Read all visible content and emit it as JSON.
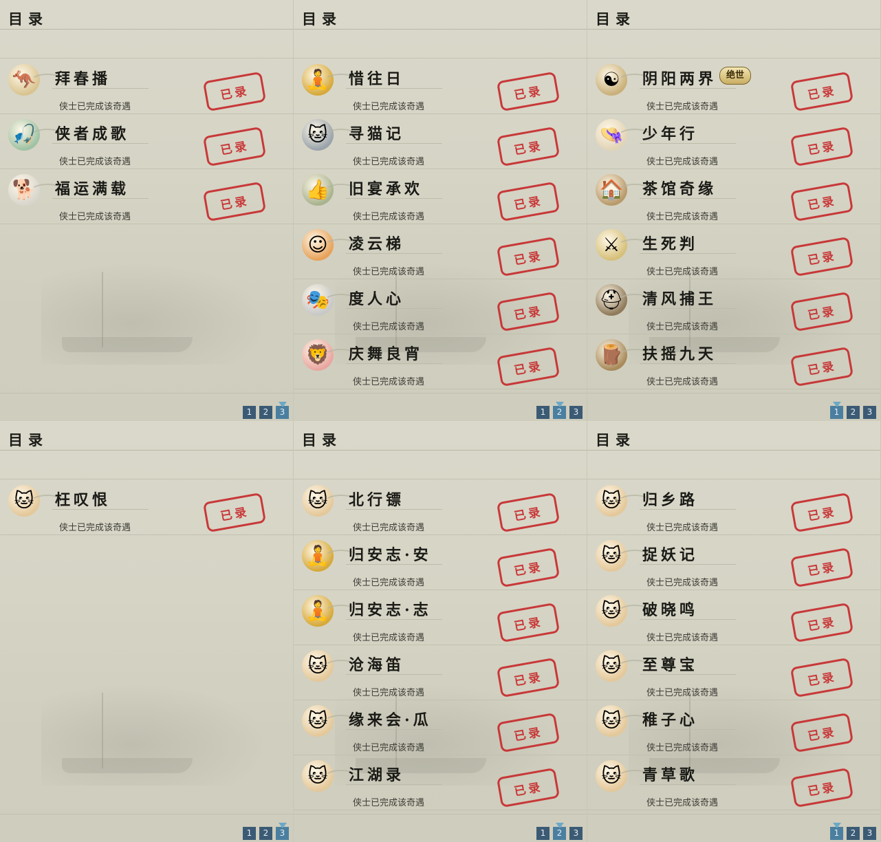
{
  "status_text": "侠士已完成该奇遇",
  "stamp_text": "已录",
  "panels": [
    {
      "title": "目录",
      "pages": [
        "1",
        "2",
        "3"
      ],
      "active_page": 2,
      "items": [
        {
          "name": "拜春播",
          "icon": "kangaroo-icon",
          "glyph": "🦘",
          "bg": "#d9c490"
        },
        {
          "name": "侠者成歌",
          "icon": "fisherman-icon",
          "glyph": "🎣",
          "bg": "#9fc2a4"
        },
        {
          "name": "福运满载",
          "icon": "dog-icon",
          "glyph": "🐕",
          "bg": "#d9d6cd"
        }
      ]
    },
    {
      "title": "目录",
      "pages": [
        "1",
        "2",
        "3"
      ],
      "active_page": 1,
      "items": [
        {
          "name": "惜往日",
          "icon": "gold-buddha-icon",
          "glyph": "🧘",
          "bg": "#d6a93a"
        },
        {
          "name": "寻猫记",
          "icon": "cat-icon",
          "glyph": "🐱",
          "bg": "#9aa3ab"
        },
        {
          "name": "旧宴承欢",
          "icon": "thumbs-up-icon",
          "glyph": "👍",
          "bg": "#a9b38e"
        },
        {
          "name": "凌云梯",
          "icon": "sun-face-icon",
          "glyph": "☺",
          "bg": "#e7a25a"
        },
        {
          "name": "度人心",
          "icon": "mask-icon",
          "glyph": "🎭",
          "bg": "#c8c8c8"
        },
        {
          "name": "庆舞良宵",
          "icon": "lion-dance-icon",
          "glyph": "🦁",
          "bg": "#e9a6a0"
        }
      ]
    },
    {
      "title": "目录",
      "pages": [
        "1",
        "2",
        "3"
      ],
      "active_page": 0,
      "items": [
        {
          "name": "阴阳两界",
          "icon": "yin-yang-icon",
          "glyph": "☯",
          "bg": "#c9b07a",
          "badge": "绝世"
        },
        {
          "name": "少年行",
          "icon": "straw-hat-boy-icon",
          "glyph": "👒",
          "bg": "#e2d4b6"
        },
        {
          "name": "茶馆奇缘",
          "icon": "teahouse-icon",
          "glyph": "🏠",
          "bg": "#b89a6a"
        },
        {
          "name": "生死判",
          "icon": "sword-gold-icon",
          "glyph": "⚔",
          "bg": "#d6c07a"
        },
        {
          "name": "清风捕王",
          "icon": "helmet-icon",
          "glyph": "⛑",
          "bg": "#8f7a5a"
        },
        {
          "name": "扶摇九天",
          "icon": "wooden-post-icon",
          "glyph": "🪵",
          "bg": "#a88a5a"
        }
      ]
    },
    {
      "title": "目录",
      "pages": [
        "1",
        "2",
        "3"
      ],
      "active_page": 2,
      "items": [
        {
          "name": "枉叹恨",
          "icon": "cat-face-icon",
          "glyph": "🐱",
          "bg": "#e4c89a"
        }
      ]
    },
    {
      "title": "目录",
      "pages": [
        "1",
        "2",
        "3"
      ],
      "active_page": 1,
      "items": [
        {
          "name": "北行镖",
          "icon": "cat-face-icon",
          "glyph": "🐱",
          "bg": "#e4c89a"
        },
        {
          "name": "归安志·安",
          "icon": "gold-buddha-icon",
          "glyph": "🧘",
          "bg": "#d6a93a"
        },
        {
          "name": "归安志·志",
          "icon": "gold-buddha-icon",
          "glyph": "🧘",
          "bg": "#d6a93a"
        },
        {
          "name": "沧海笛",
          "icon": "cat-face-icon",
          "glyph": "🐱",
          "bg": "#e4c89a"
        },
        {
          "name": "缘来会·瓜",
          "icon": "cat-face-icon",
          "glyph": "🐱",
          "bg": "#e4c89a"
        },
        {
          "name": "江湖录",
          "icon": "cat-face-icon",
          "glyph": "🐱",
          "bg": "#e4c89a"
        }
      ]
    },
    {
      "title": "目录",
      "pages": [
        "1",
        "2",
        "3"
      ],
      "active_page": 0,
      "items": [
        {
          "name": "归乡路",
          "icon": "cat-face-icon",
          "glyph": "🐱",
          "bg": "#e4c89a"
        },
        {
          "name": "捉妖记",
          "icon": "cat-face-icon",
          "glyph": "🐱",
          "bg": "#e4c89a"
        },
        {
          "name": "破晓鸣",
          "icon": "cat-face-icon",
          "glyph": "🐱",
          "bg": "#e4c89a"
        },
        {
          "name": "至尊宝",
          "icon": "cat-face-icon",
          "glyph": "🐱",
          "bg": "#e4c89a"
        },
        {
          "name": "稚子心",
          "icon": "cat-face-icon",
          "glyph": "🐱",
          "bg": "#e4c89a"
        },
        {
          "name": "青草歌",
          "icon": "cat-face-icon",
          "glyph": "🐱",
          "bg": "#e4c89a"
        }
      ]
    }
  ]
}
